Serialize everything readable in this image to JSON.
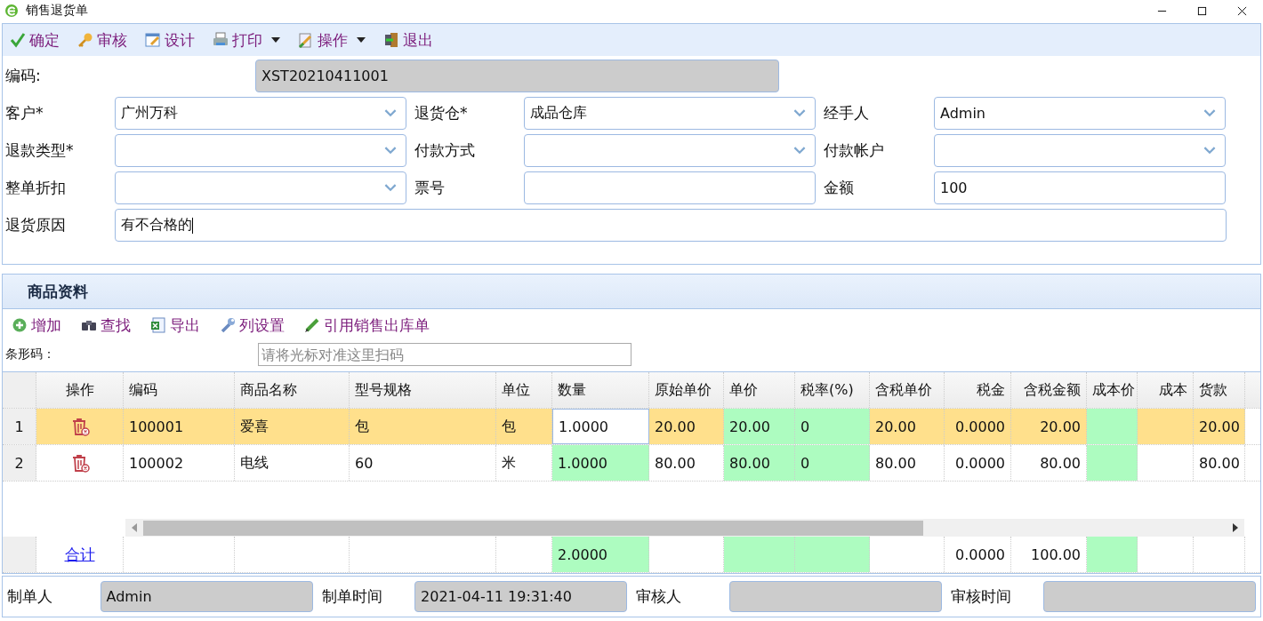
{
  "window": {
    "title": "销售退货单"
  },
  "toolbar": [
    {
      "label": "确定",
      "dropdown": false
    },
    {
      "label": "审核",
      "dropdown": false
    },
    {
      "label": "设计",
      "dropdown": false
    },
    {
      "label": "打印",
      "dropdown": true
    },
    {
      "label": "操作",
      "dropdown": true
    },
    {
      "label": "退出",
      "dropdown": false
    }
  ],
  "code": {
    "label": "编码:",
    "value": "XST20210411001"
  },
  "fields": [
    {
      "label": "客户*",
      "kind": "select",
      "value": "广州万科"
    },
    {
      "label": "退货仓*",
      "kind": "select",
      "value": "成品仓库"
    },
    {
      "label": "经手人",
      "kind": "select",
      "value": "Admin"
    },
    {
      "label": "退款类型*",
      "kind": "select"
    },
    {
      "label": "付款方式",
      "kind": "select"
    },
    {
      "label": "付款帐户",
      "kind": "select"
    },
    {
      "label": "整单折扣",
      "kind": "select"
    },
    {
      "label": "票号",
      "kind": "text"
    },
    {
      "label": "金额",
      "kind": "text",
      "value": "100"
    }
  ],
  "reason": {
    "label": "退货原因",
    "value": "有不合格的"
  },
  "goods": {
    "title": "商品资料",
    "toolbar": [
      "增加",
      "查找",
      "导出",
      "列设置",
      "引用销售出库单"
    ],
    "barcode": {
      "label": "条形码：",
      "placeholder": "请将光标对准这里扫码"
    },
    "columns": [
      {
        "label": "操作",
        "kind": "action"
      },
      {
        "label": "编码",
        "kind": "text"
      },
      {
        "label": "商品名称",
        "kind": "text"
      },
      {
        "label": "型号规格",
        "kind": "text"
      },
      {
        "label": "单位",
        "kind": "text"
      },
      {
        "label": "数量",
        "kind": "editable"
      },
      {
        "label": "原始单价",
        "kind": "text"
      },
      {
        "label": "单价",
        "kind": "editable"
      },
      {
        "label": "税率(%)",
        "kind": "editable"
      },
      {
        "label": "含税单价",
        "kind": "text"
      },
      {
        "label": "税金",
        "kind": "text"
      },
      {
        "label": "含税金额",
        "kind": "text"
      },
      {
        "label": "成本价",
        "kind": "editable"
      },
      {
        "label": "成本",
        "kind": "text"
      },
      {
        "label": "货款",
        "kind": "text"
      }
    ],
    "rows": [
      {
        "number": "1",
        "selected": true,
        "cells": [
          "",
          "100001",
          "爱喜",
          "包",
          "包",
          "1.0000",
          "20.00",
          "20.00",
          "0",
          "20.00",
          "0.0000",
          "20.00",
          null,
          null,
          "20.00"
        ]
      },
      {
        "number": "2",
        "selected": false,
        "cells": [
          "",
          "100002",
          "电线",
          "60",
          "米",
          "1.0000",
          "80.00",
          "80.00",
          "0",
          "80.00",
          "0.0000",
          "80.00",
          null,
          null,
          "80.00"
        ]
      }
    ],
    "summary": {
      "link": "合计",
      "cells": [
        null,
        null,
        null,
        null,
        null,
        "2.0000",
        null,
        null,
        null,
        null,
        "0.0000",
        "100.00",
        null,
        null,
        null
      ]
    }
  },
  "footer": [
    {
      "label": "制单人",
      "value": "Admin"
    },
    {
      "label": "制单时间",
      "value": "2021-04-11 19:31:40"
    },
    {
      "label": "审核人"
    },
    {
      "label": "审核时间"
    }
  ]
}
